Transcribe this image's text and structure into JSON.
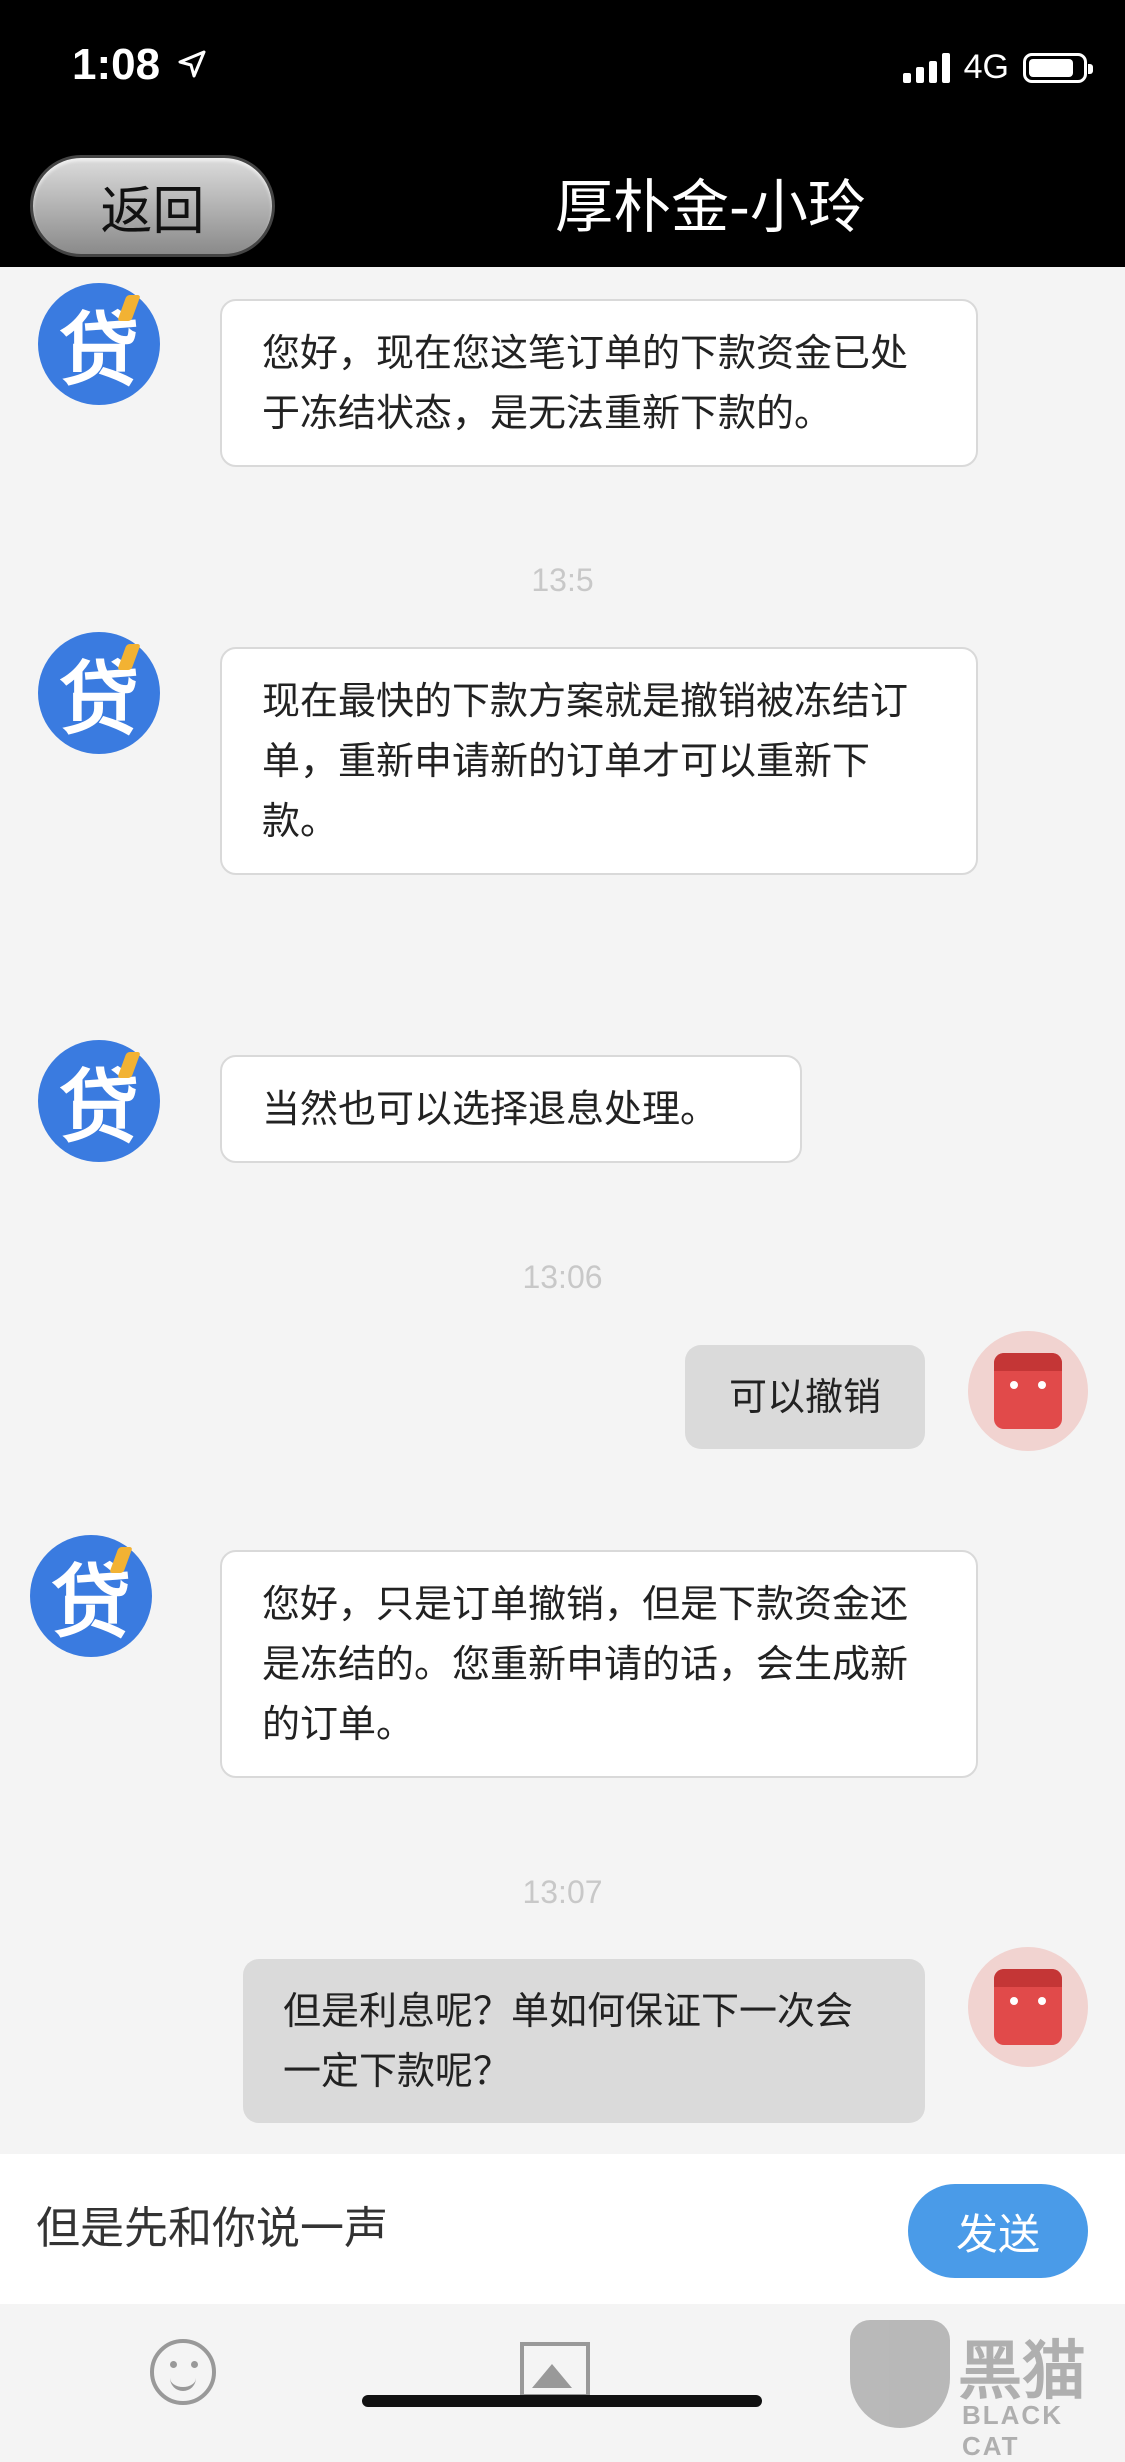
{
  "status": {
    "time": "1:08",
    "network": "4G",
    "location_icon": "location-arrow-icon",
    "signal_icon": "signal-bars-icon",
    "battery_icon": "battery-icon"
  },
  "nav": {
    "back_label": "返回",
    "title": "厚朴金-小玲"
  },
  "messages": [
    {
      "from": "bot",
      "text": "您好，现在您这笔订单的下款资金已处于冻结状态，是无法重新下款的。"
    },
    {
      "timestamp": "13:5"
    },
    {
      "from": "bot",
      "text": "现在最快的下款方案就是撤销被冻结订单，重新申请新的订单才可以重新下款。"
    },
    {
      "from": "bot",
      "text": "当然也可以选择退息处理。"
    },
    {
      "timestamp": "13:06"
    },
    {
      "from": "user",
      "text": "可以撤销"
    },
    {
      "from": "bot",
      "text": "您好，只是订单撤销，但是下款资金还是冻结的。您重新申请的话，会生成新的订单。"
    },
    {
      "timestamp": "13:07"
    },
    {
      "from": "user",
      "text": "但是利息呢？单如何保证下一次会一定下款呢？"
    }
  ],
  "bot_avatar_char": "贷",
  "input": {
    "value": "但是先和你说一声",
    "send_label": "发送"
  },
  "toolbar": {
    "emoji_icon": "emoji-icon",
    "image_icon": "image-icon"
  },
  "watermark": {
    "cn": "黑猫",
    "en": "BLACK CAT"
  },
  "colors": {
    "bot_avatar": "#3a7be0",
    "send_button": "#4a9be8",
    "user_bubble": "#dadada"
  }
}
